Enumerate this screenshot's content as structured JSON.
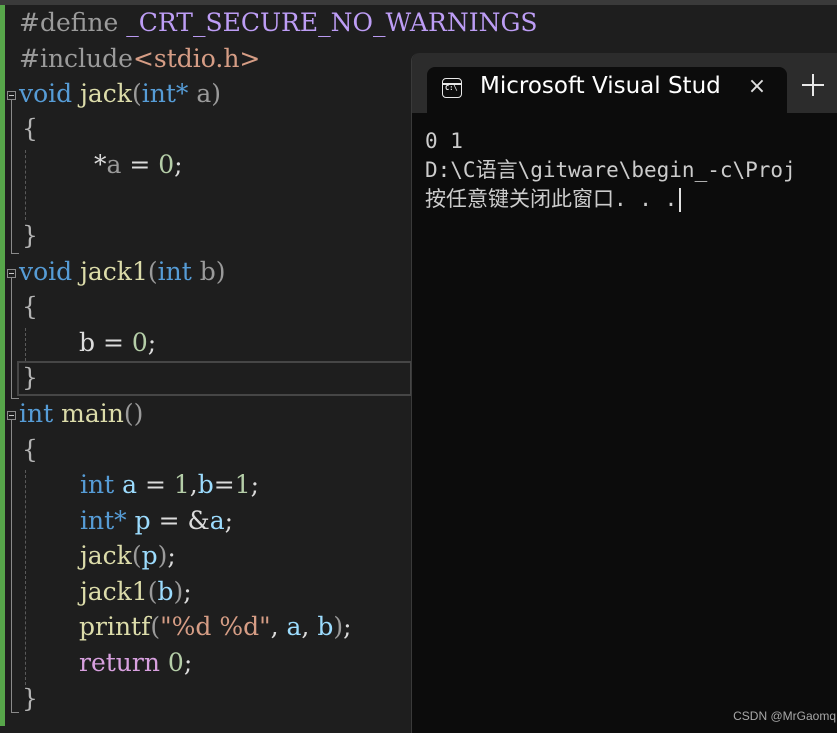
{
  "editor": {
    "lines": {
      "l1": {
        "directive": "#define",
        "macro": "_CRT_SECURE_NO_WARNINGS"
      },
      "l2": {
        "directive": "#include",
        "header": "<stdio.h>"
      },
      "l3": {
        "type": "void",
        "name": "jack",
        "open": "(",
        "ptype": "int*",
        "param": "a",
        "close": ")"
      },
      "l4": {
        "brace": "{"
      },
      "l5": {
        "text_star": "*",
        "var": "a",
        "op": " = ",
        "num": "0",
        "semi": ";"
      },
      "l7": {
        "brace": "}"
      },
      "l8": {
        "type": "void",
        "name": "jack1",
        "open": "(",
        "ptype": "int",
        "param": "b",
        "close": ")"
      },
      "l9": {
        "brace": "{"
      },
      "l10": {
        "var": "b",
        "op": " = ",
        "num": "0",
        "semi": ";"
      },
      "l11": {
        "brace": "}"
      },
      "l12": {
        "type": "int",
        "name": "main",
        "parens": "()"
      },
      "l13": {
        "brace": "{"
      },
      "l14": {
        "type": "int",
        "v1": "a",
        "eq": " = ",
        "n1": "1",
        "comma": ",",
        "v2": "b",
        "eq2": "=",
        "n2": "1",
        "semi": ";"
      },
      "l15": {
        "type": "int*",
        "v": "p",
        "eq": " = ",
        "amp": "&",
        "a": "a",
        "semi": ";"
      },
      "l16": {
        "fn": "jack",
        "open": "(",
        "arg": "p",
        "close": ")",
        "semi": ";"
      },
      "l17": {
        "fn": "jack1",
        "open": "(",
        "arg": "b",
        "close": ")",
        "semi": ";"
      },
      "l18": {
        "fn": "printf",
        "open": "(",
        "str": "\"%d %d\"",
        "sep1": ", ",
        "a": "a",
        "sep2": ", ",
        "b": "b",
        "close": ")",
        "semi": ";"
      },
      "l19": {
        "kw": "return",
        "num": "0",
        "semi": ";"
      },
      "l20": {
        "brace": "}"
      }
    }
  },
  "console": {
    "tab_title": "Microsoft Visual Stud",
    "tab_icon": "console-icon",
    "tab_icon_text": "C:\\",
    "close_glyph": "×",
    "output": [
      "0 1",
      "D:\\C语言\\gitware\\begin_-c\\Proj",
      "按任意键关闭此窗口. . ."
    ]
  },
  "watermark": "CSDN @MrGaomq"
}
